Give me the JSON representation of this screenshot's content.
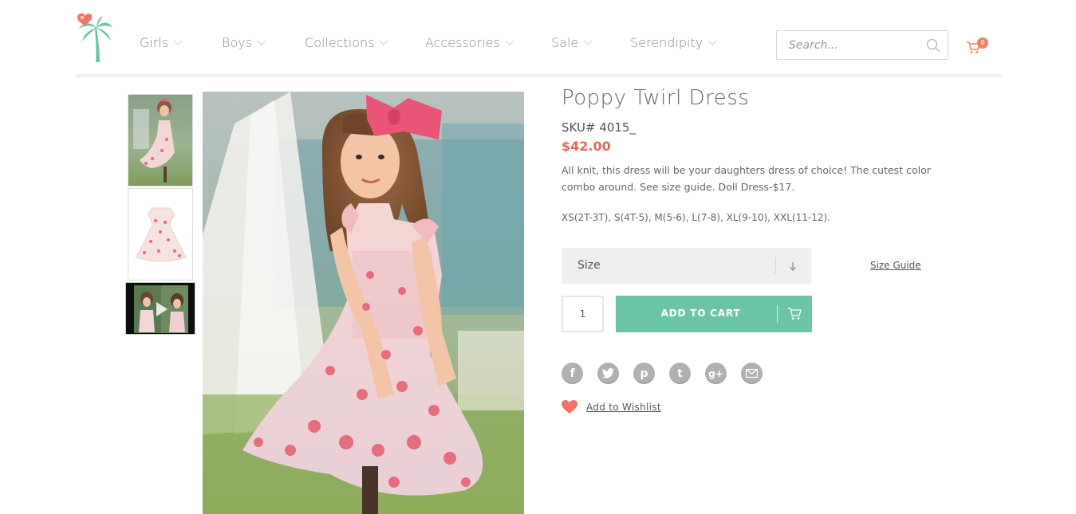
{
  "nav": {
    "items": [
      {
        "label": "Girls"
      },
      {
        "label": "Boys"
      },
      {
        "label": "Collections"
      },
      {
        "label": "Accessories"
      },
      {
        "label": "Sale"
      },
      {
        "label": "Serendipity"
      }
    ],
    "search_placeholder": "Search...",
    "cart_count": "0"
  },
  "product": {
    "title": "Poppy Twirl Dress",
    "sku": "SKU# 4015_",
    "price": "$42.00",
    "description": "All knit, this dress will be your daughters dress of choice! The cutest color combo around. See size guide. Doll Dress-$17.",
    "sizes": "XS(2T-3T), S(4T-5), M(5-6), L(7-8), XL(9-10), XXL(11-12).",
    "size_select_label": "Size",
    "size_guide_label": "Size Guide",
    "quantity": "1",
    "add_to_cart_label": "ADD TO CART",
    "wishlist_label": "Add to Wishlist"
  },
  "social": [
    "facebook-icon",
    "twitter-icon",
    "pinterest-icon",
    "tumblr-icon",
    "google-plus-icon",
    "email-icon"
  ],
  "colors": {
    "accent_green": "#6cc6a6",
    "price_red": "#e06a5a",
    "heart": "#ee7566",
    "cart_badge": "#ee8467"
  }
}
